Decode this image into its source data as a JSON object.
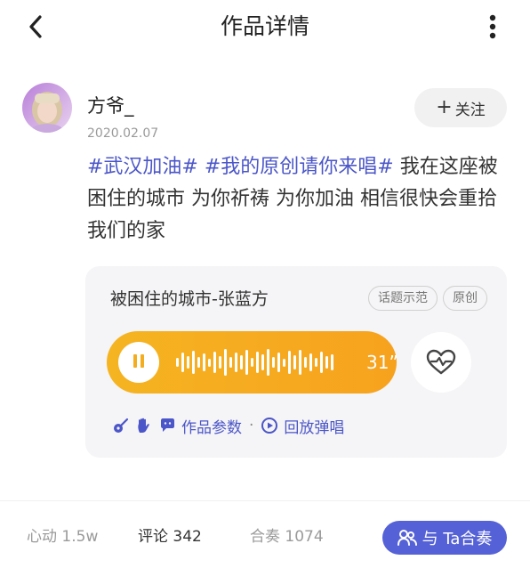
{
  "header": {
    "title": "作品详情",
    "back_icon": "chevron-left-icon",
    "more_icon": "more-vertical-icon"
  },
  "post": {
    "author": "方爷_",
    "date": "2020.02.07",
    "follow_label": "关注",
    "tags": [
      "#武汉加油#",
      "#我的原创请你来唱#"
    ],
    "text": " 我在这座被困住的城市 为你祈祷 为你加油 相信很快会重拾我们的家"
  },
  "song": {
    "title": "被困住的城市-张蓝方",
    "badges": [
      "话题示范",
      "原创"
    ],
    "duration": "31”",
    "params_label": "作品参数",
    "replay_label": "回放弹唱"
  },
  "footer": {
    "heart_label": "心动",
    "heart_count": "1.5w",
    "comment_label": "评论",
    "comment_count": "342",
    "ensemble_label": "合奏",
    "ensemble_count": "1074",
    "cta_label": "与 Ta合奏"
  },
  "colors": {
    "accent": "#5561d6",
    "tag": "#4b56c8",
    "player": "#f5ad20"
  }
}
